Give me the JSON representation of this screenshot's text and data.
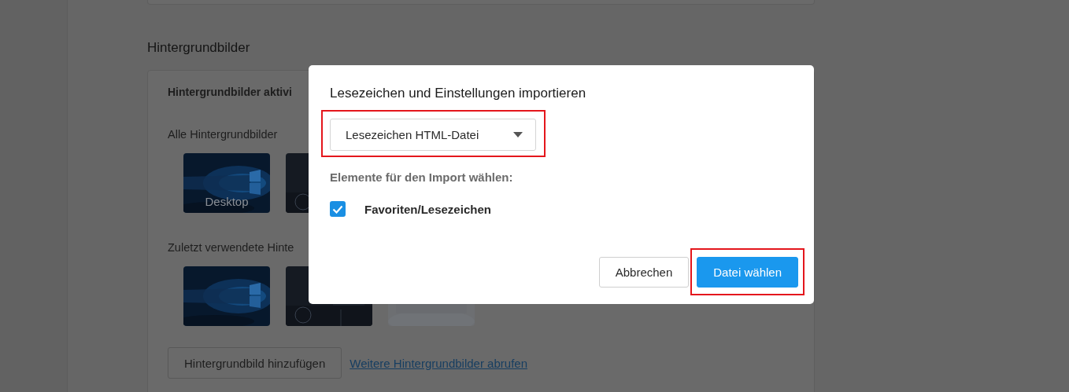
{
  "page": {
    "section_title": "Hintergrundbilder",
    "toggle_label": "Hintergrundbilder aktivi",
    "all_label": "Alle Hintergrundbilder",
    "all_wallpapers": [
      {
        "kind": "picture",
        "caption": "Desktop"
      },
      {
        "kind": "picture"
      }
    ],
    "recent_label": "Zuletzt verwendete Hinte",
    "recent_wallpapers": [
      {
        "kind": "picture"
      },
      {
        "kind": "picture"
      },
      {
        "kind": "picture"
      }
    ],
    "add_button": "Hintergrundbild hinzufügen",
    "more_link": "Weitere Hintergrundbilder abrufen"
  },
  "dialog": {
    "title": "Lesezeichen und Einstellungen importieren",
    "source_select": {
      "value": "Lesezeichen HTML-Datei",
      "highlighted": true
    },
    "items_label": "Elemente für den Import wählen:",
    "items": [
      {
        "label": "Favoriten/Lesezeichen",
        "checked": true
      }
    ],
    "buttons": [
      {
        "label": "Abbrechen",
        "kind": "secondary"
      },
      {
        "label": "Datei wählen",
        "kind": "primary",
        "highlighted": true
      }
    ]
  }
}
